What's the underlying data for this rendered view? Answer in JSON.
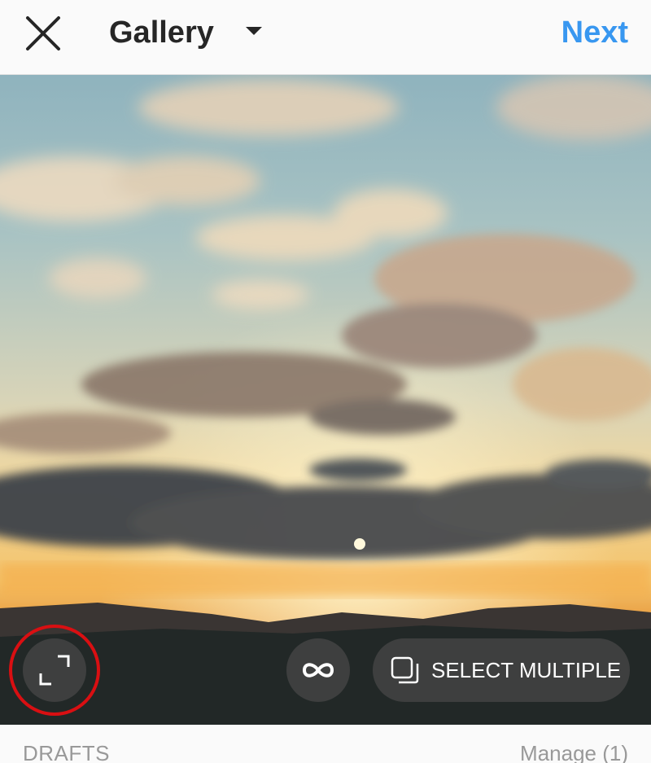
{
  "header": {
    "title": "Gallery",
    "next_label": "Next",
    "close_icon": "close-icon",
    "dropdown_icon": "chevron-down-icon"
  },
  "preview": {
    "description_icons": {
      "expand": "expand-icon",
      "boomerang": "infinity-icon",
      "multi": "multiple-select-icon"
    },
    "select_multiple_label": "SELECT MULTIPLE"
  },
  "footer": {
    "drafts_label": "DRAFTS",
    "manage_label": "Manage (1)"
  },
  "colors": {
    "accent": "#3897f0",
    "highlight_ring": "#d90f12",
    "title": "#262626",
    "muted": "#999999"
  }
}
